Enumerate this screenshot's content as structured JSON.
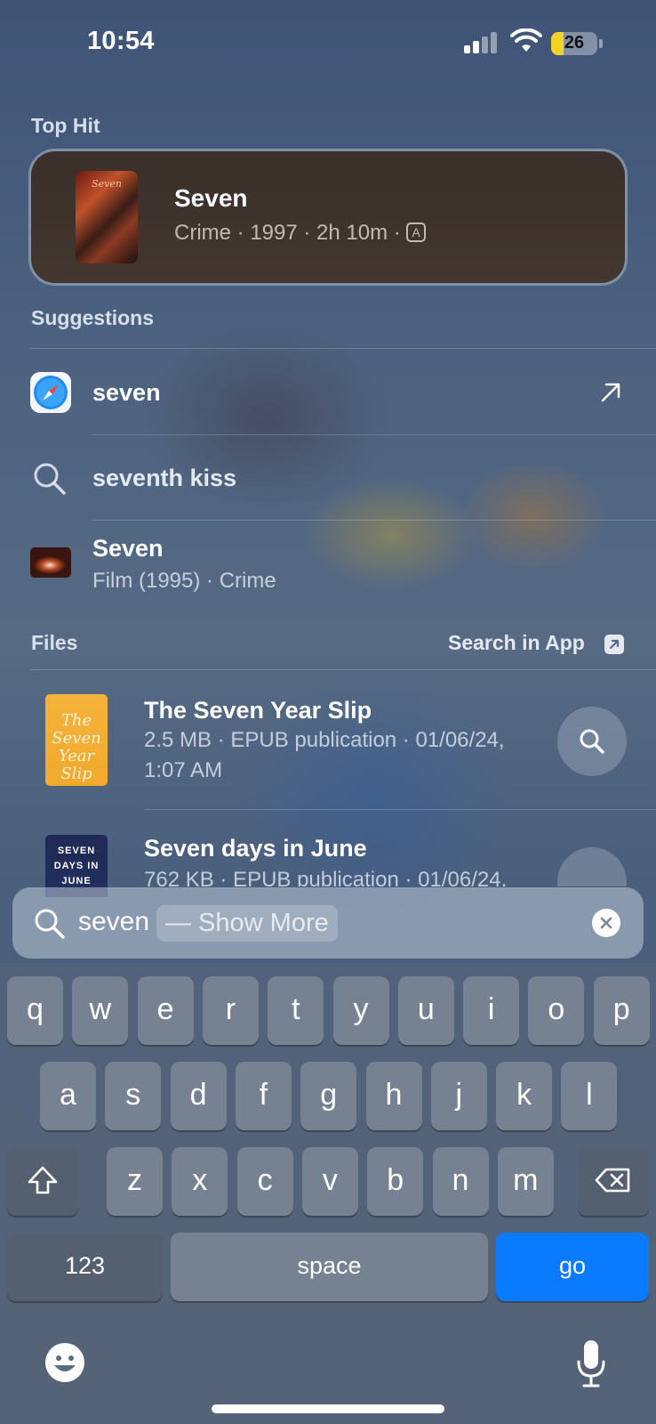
{
  "status_bar": {
    "time": "10:54",
    "battery": "26",
    "battery_level": 0.26
  },
  "top_hit": {
    "section_label": "Top Hit",
    "title": "Seven",
    "subtitle": "Crime · 1997 · 2h 10m ·",
    "rating_badge": "A",
    "poster_text": "Seven"
  },
  "suggestions": {
    "section_label": "Suggestions",
    "items": [
      {
        "title": "seven",
        "icon": "safari-icon",
        "trailing_icon": "arrow-up-right-icon"
      },
      {
        "title": "seventh kiss",
        "icon": "search-icon"
      },
      {
        "title": "Seven",
        "subtitle": "Film (1995) · Crime",
        "icon": "film-thumbnail"
      }
    ]
  },
  "files": {
    "section_label": "Files",
    "search_in_app": "Search in App",
    "items": [
      {
        "title": "The Seven Year Slip",
        "subtitle_line1": "2.5 MB · EPUB publication · 01/06/24,",
        "subtitle_line2": "1:07 AM",
        "cover_text": "The Seven Year Slip"
      },
      {
        "title": "Seven days in June",
        "subtitle_line1": "762 KB · EPUB publication · 01/06/24,",
        "cover_text": "SEVEN DAYS IN JUNE"
      }
    ]
  },
  "search_bar": {
    "query": "seven",
    "completion": "—  Show More"
  },
  "keyboard": {
    "row1": [
      "q",
      "w",
      "e",
      "r",
      "t",
      "y",
      "u",
      "i",
      "o",
      "p"
    ],
    "row2": [
      "a",
      "s",
      "d",
      "f",
      "g",
      "h",
      "j",
      "k",
      "l"
    ],
    "row3": [
      "z",
      "x",
      "c",
      "v",
      "b",
      "n",
      "m"
    ],
    "numbers_label": "123",
    "space_label": "space",
    "go_label": "go"
  },
  "colors": {
    "accent": "#0a7aff",
    "battery": "#f5d328"
  }
}
